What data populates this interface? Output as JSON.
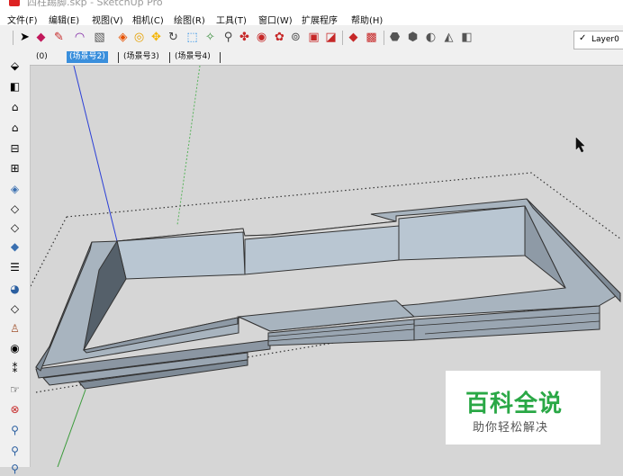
{
  "window": {
    "title": "四柱踢脚.skp - SketchUp Pro"
  },
  "menu": [
    "文件(F)",
    "编辑(E)",
    "视图(V)",
    "相机(C)",
    "绘图(R)",
    "工具(T)",
    "窗口(W)",
    "扩展程序",
    "帮助(H)"
  ],
  "layer": {
    "check": "✓",
    "name": "Layer0"
  },
  "scene_tabs": [
    "(0)",
    "(场景号2)",
    "(场景号3)",
    "(场景号4)"
  ],
  "active_tab_index": 1,
  "watermark": {
    "main": "百科全说",
    "sub": "助你轻松解决"
  },
  "colors": {
    "accent": "#3a8fdc",
    "watermark_green": "#2aa846",
    "background": "#d6d6d6",
    "model_face": "#a8b4bf"
  },
  "icons": {
    "toolbar": [
      "select-icon",
      "eraser-icon",
      "pencil-icon",
      "arc-icon",
      "rectangle-icon",
      "push-pull-icon",
      "offset-icon",
      "move-icon",
      "rotate-icon",
      "scale-icon",
      "follow-me-icon",
      "tape-measure-icon",
      "text-icon",
      "orbit-icon",
      "pan-icon",
      "zoom-icon",
      "zoom-extents-icon",
      "component-icon",
      "section-icon",
      "style-icon",
      "material-icon",
      "paint-icon",
      "shadow-icon",
      "fog-icon"
    ],
    "left": [
      "iso-view-icon",
      "front-view-icon",
      "top-view-icon",
      "right-view-icon",
      "back-view-icon",
      "left-view-icon",
      "xray-icon",
      "wireframe-icon",
      "hidden-line-icon",
      "shaded-icon",
      "textured-icon",
      "monochrome-icon",
      "eraser-tool-icon",
      "paint-tool-icon",
      "look-around-icon",
      "walk-icon",
      "position-camera-icon",
      "orbit-tool-icon",
      "zoom-window-icon",
      "zoom-tool-icon",
      "zoom-extents-tool-icon"
    ]
  }
}
